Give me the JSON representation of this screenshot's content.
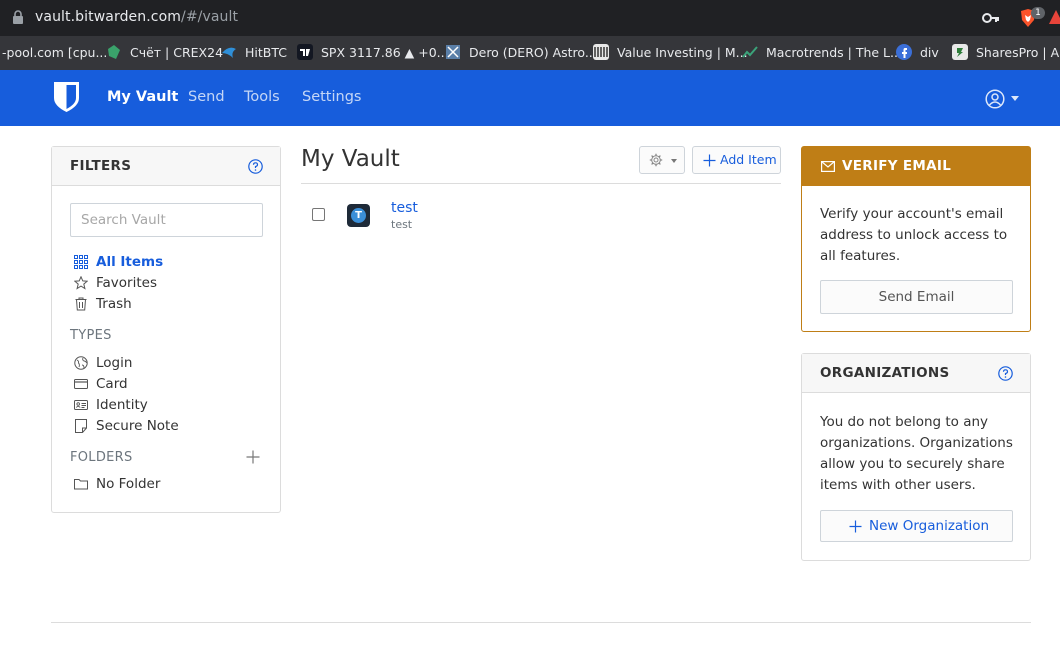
{
  "browser": {
    "url_host": "vault.bitwarden.com",
    "url_path": "/#/vault",
    "extension_badge": "1",
    "bookmarks": [
      {
        "label": "-pool.com [cpu...",
        "color": "#35363a"
      },
      {
        "label": "Счёт | CREX24",
        "color": "#3aa36b"
      },
      {
        "label": "HitBTC",
        "color": "#2f8fd8"
      },
      {
        "label": "SPX 3117.86 ▲ +0....",
        "color": "#131722"
      },
      {
        "label": "Dero (DERO) Astro...",
        "color": "#5a7fa8"
      },
      {
        "label": "Value Investing | M...",
        "color": "#d9d9d9"
      },
      {
        "label": "Macrotrends | The L...",
        "color": "#3ba37a"
      },
      {
        "label": "div",
        "color": "#3b6fd8"
      },
      {
        "label": "SharesPro | Акц",
        "color": "#e8e8e8"
      }
    ]
  },
  "navbar": {
    "links": [
      "My Vault",
      "Send",
      "Tools",
      "Settings"
    ],
    "brand_color": "#175ddc"
  },
  "filters": {
    "title": "FILTERS",
    "search_placeholder": "Search Vault",
    "items": [
      "All Items",
      "Favorites",
      "Trash"
    ],
    "types_label": "TYPES",
    "types": [
      "Login",
      "Card",
      "Identity",
      "Secure Note"
    ],
    "folders_label": "FOLDERS",
    "folders": [
      "No Folder"
    ]
  },
  "vault": {
    "title": "My Vault",
    "add_item_label": "Add Item",
    "items": [
      {
        "name": "test",
        "subtitle": "test",
        "icon_letter": "T"
      }
    ]
  },
  "verify_email": {
    "title": "VERIFY EMAIL",
    "body": "Verify your account's email address to unlock access to all features.",
    "button": "Send Email",
    "accent": "#bf7e16"
  },
  "organizations": {
    "title": "ORGANIZATIONS",
    "body": "You do not belong to any organizations. Organizations allow you to securely share items with other users.",
    "button": "New Organization"
  }
}
